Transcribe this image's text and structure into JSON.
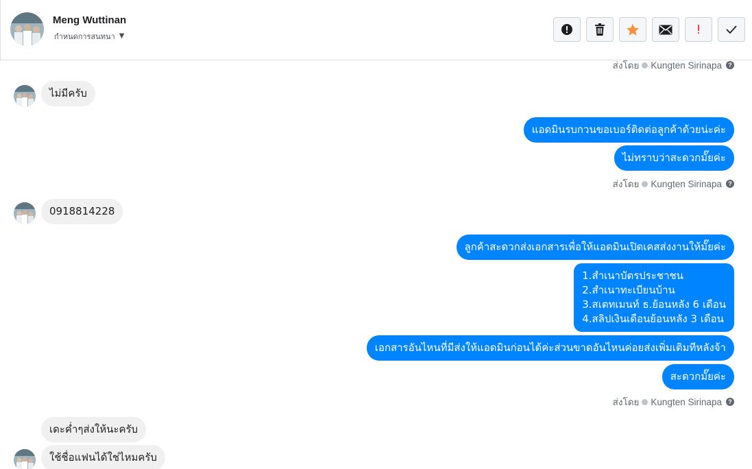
{
  "header": {
    "name": "Meng Wuttinan",
    "subline": "กำหนดการสนทนา",
    "actions": [
      {
        "icon": "alert-circle-icon",
        "label": "exclamation"
      },
      {
        "icon": "trash-icon",
        "label": "delete"
      },
      {
        "icon": "star-icon",
        "label": "star",
        "color": "#f7923b"
      },
      {
        "icon": "envelope-icon",
        "label": "mail"
      },
      {
        "icon": "exclamation-icon",
        "label": "spam",
        "color": "#fa3e3e"
      },
      {
        "icon": "check-icon",
        "label": "done"
      }
    ]
  },
  "sent_by": {
    "prefix": "ส่งโดย",
    "agent": "Kungten Sirinapa",
    "help": "?"
  },
  "messages": {
    "m1": "ไม่มีครับ",
    "m2": "แอดมินรบกวนขอเบอร์ติดต่อลูกค้าด้วยน่ะค่ะ",
    "m3": "ไม่ทราบว่าสะดวกมั๊ยค่ะ",
    "m4": "0918814228",
    "m5": "ลูกค้าสะดวกส่งเอกสารเพื่อให้แอดมินเปิดเคสส่งงานให้มั๊ยค่ะ",
    "m6": [
      "1.สำเนาบัตรประชาชน",
      "2.สำเนาทะเบียนบ้าน",
      "3.สเตทเมนท์ ธ.ย้อนหลัง 6 เดือน",
      "4.สลิปเงินเดือนย้อนหลัง 3 เดือน"
    ],
    "m7": "เอกสารอันไหนที่มีส่งให้แอดมินก่อนได้ค่ะส่วนขาดอันไหนค่อยส่งเพิ่มเติมทีหลังจ้า",
    "m8": "สะดวกมั๊ยค่ะ",
    "m9": "เดะค่ำๆส่งให้นะครับ",
    "m10": "ใช้ชื่อแฟนได้ใช่ไหมครับ"
  },
  "colors": {
    "outgoing": "#0084ff",
    "incoming": "#f1f0f0",
    "meta_text": "#606770"
  }
}
